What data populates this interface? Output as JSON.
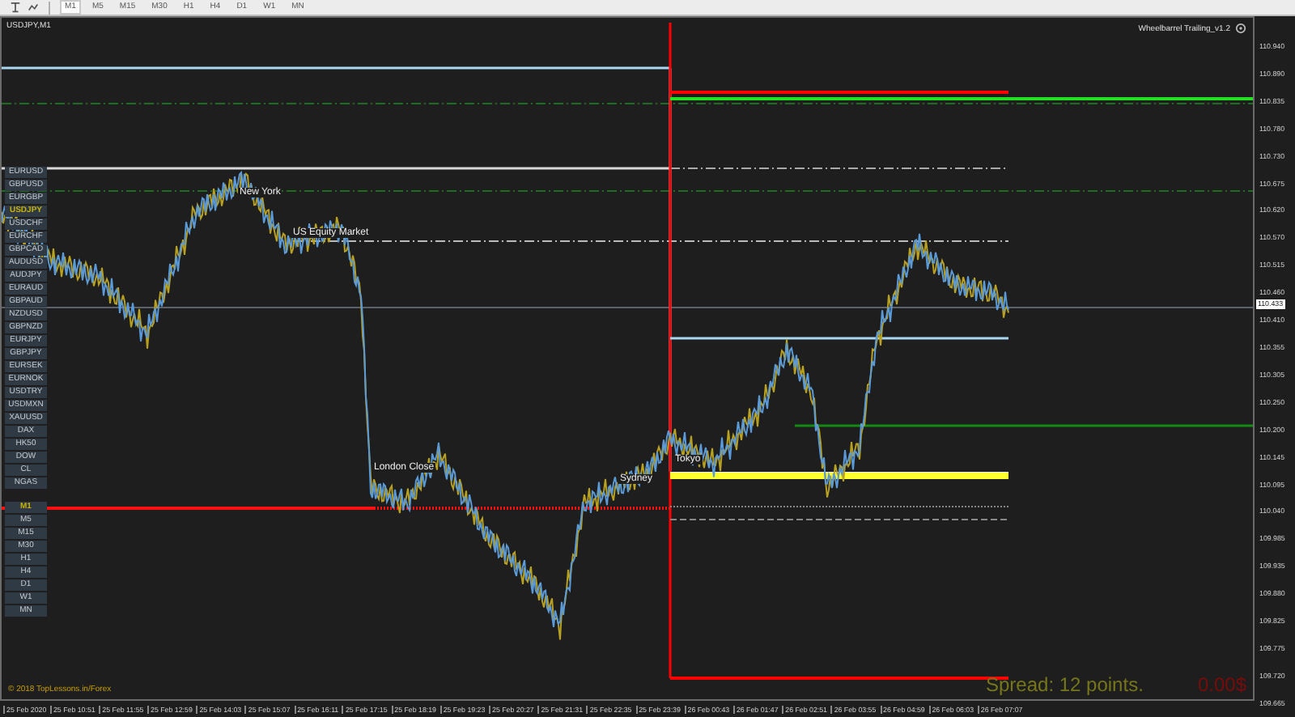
{
  "toolbar": {
    "timeframes": [
      {
        "label": "M1",
        "selected": true
      },
      {
        "label": "M5",
        "selected": false
      },
      {
        "label": "M15",
        "selected": false
      },
      {
        "label": "M30",
        "selected": false
      },
      {
        "label": "H1",
        "selected": false
      },
      {
        "label": "H4",
        "selected": false
      },
      {
        "label": "D1",
        "selected": false
      },
      {
        "label": "W1",
        "selected": false
      },
      {
        "label": "MN",
        "selected": false
      }
    ]
  },
  "chart": {
    "title": "USDJPY,M1",
    "indicator": "Wheelbarrel Trailing_v1.2",
    "symbols": [
      {
        "label": "EURUSD",
        "selected": false
      },
      {
        "label": "GBPUSD",
        "selected": false
      },
      {
        "label": "EURGBP",
        "selected": false
      },
      {
        "label": "USDJPY",
        "selected": true
      },
      {
        "label": "USDCHF",
        "selected": false
      },
      {
        "label": "EURCHF",
        "selected": false
      },
      {
        "label": "GBPCAD",
        "selected": false
      },
      {
        "label": "AUDUSD",
        "selected": false
      },
      {
        "label": "AUDJPY",
        "selected": false
      },
      {
        "label": "EURAUD",
        "selected": false
      },
      {
        "label": "GBPAUD",
        "selected": false
      },
      {
        "label": "NZDUSD",
        "selected": false
      },
      {
        "label": "GBPNZD",
        "selected": false
      },
      {
        "label": "EURJPY",
        "selected": false
      },
      {
        "label": "GBPJPY",
        "selected": false
      },
      {
        "label": "EURSEK",
        "selected": false
      },
      {
        "label": "EURNOK",
        "selected": false
      },
      {
        "label": "USDTRY",
        "selected": false
      },
      {
        "label": "USDMXN",
        "selected": false
      },
      {
        "label": "XAUUSD",
        "selected": false
      },
      {
        "label": "DAX",
        "selected": false
      },
      {
        "label": "HK50",
        "selected": false
      },
      {
        "label": "DOW",
        "selected": false
      },
      {
        "label": "CL",
        "selected": false
      },
      {
        "label": "NGAS",
        "selected": false
      }
    ],
    "periods": [
      {
        "label": "M1",
        "selected": true
      },
      {
        "label": "M5",
        "selected": false
      },
      {
        "label": "M15",
        "selected": false
      },
      {
        "label": "M30",
        "selected": false
      },
      {
        "label": "H1",
        "selected": false
      },
      {
        "label": "H4",
        "selected": false
      },
      {
        "label": "D1",
        "selected": false
      },
      {
        "label": "W1",
        "selected": false
      },
      {
        "label": "MN",
        "selected": false
      }
    ],
    "sessions": [
      {
        "label": "New York"
      },
      {
        "label": "US Equity Market"
      },
      {
        "label": "London Close"
      },
      {
        "label": "Sydney"
      },
      {
        "label": "Tokyo"
      }
    ],
    "copyright": "© 2018 TopLessons.in/Forex",
    "spread": "Spread: 12 points.",
    "profit": "0.00$"
  },
  "price_axis": {
    "current": "110.433",
    "labels": [
      "110.940",
      "110.890",
      "110.835",
      "110.780",
      "110.730",
      "110.675",
      "110.620",
      "110.570",
      "110.515",
      "110.460",
      "110.410",
      "110.355",
      "110.305",
      "110.250",
      "110.200",
      "110.145",
      "110.095",
      "110.040",
      "109.985",
      "109.935",
      "109.880",
      "109.825",
      "109.775",
      "109.720",
      "109.665"
    ]
  },
  "time_axis": {
    "labels": [
      "25 Feb 2020",
      "25 Feb 10:51",
      "25 Feb 11:55",
      "25 Feb 12:59",
      "25 Feb 14:03",
      "25 Feb 15:07",
      "25 Feb 16:11",
      "25 Feb 17:15",
      "25 Feb 18:19",
      "25 Feb 19:23",
      "25 Feb 20:27",
      "25 Feb 21:31",
      "25 Feb 22:35",
      "25 Feb 23:39",
      "26 Feb 00:43",
      "26 Feb 01:47",
      "26 Feb 02:51",
      "26 Feb 03:55",
      "26 Feb 04:59",
      "26 Feb 06:03",
      "26 Feb 07:07"
    ]
  }
}
